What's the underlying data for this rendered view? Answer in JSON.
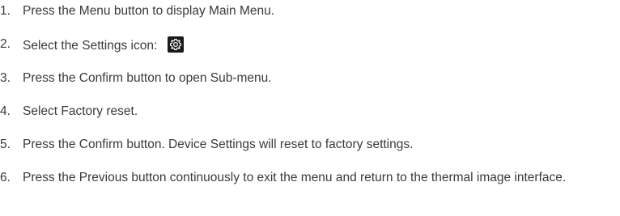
{
  "steps": [
    {
      "number": "1.",
      "text": "Press the Menu button to display Main Menu."
    },
    {
      "number": "2.",
      "text": "Select the Settings icon:",
      "icon": "settings-gear-icon"
    },
    {
      "number": "3.",
      "text": "Press the Confirm button to open Sub-menu."
    },
    {
      "number": "4.",
      "text": "Select Factory reset."
    },
    {
      "number": "5.",
      "text": "Press the Confirm button. Device Settings will reset to factory settings."
    },
    {
      "number": "6.",
      "text": "Press the Previous button continuously to exit the menu and return to the thermal image interface."
    }
  ]
}
